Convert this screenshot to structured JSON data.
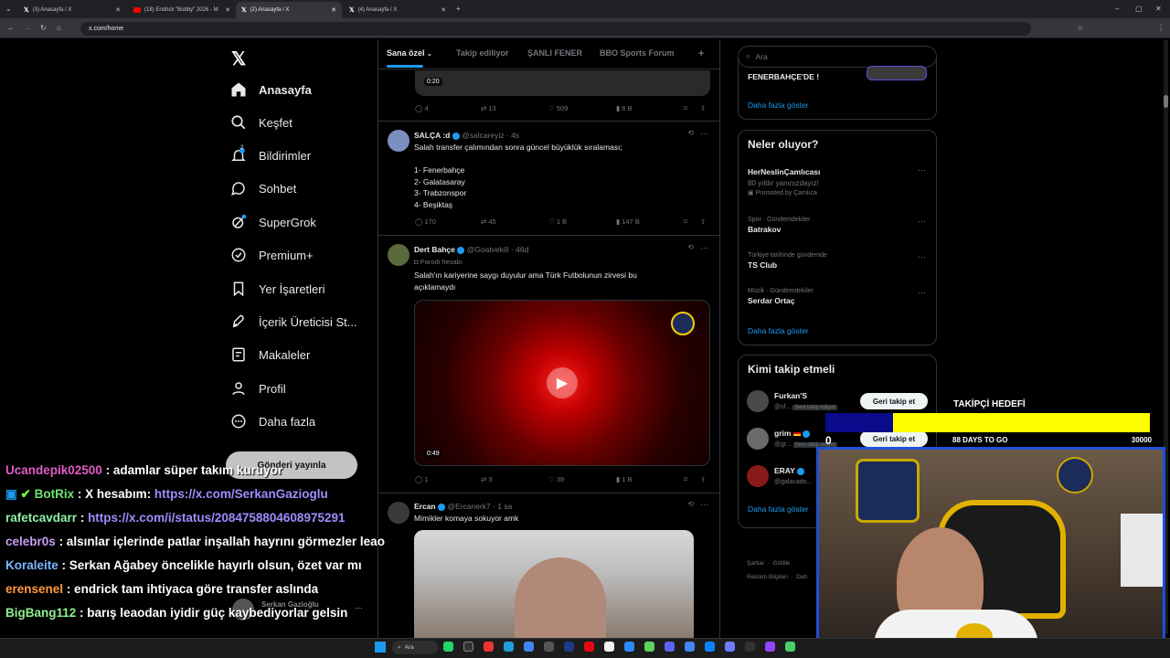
{
  "tabs": [
    {
      "title": "(3) Anasayfa / X"
    },
    {
      "title": "(18) Endrick \"Bobby\" 2026 - M"
    },
    {
      "title": "(2) Anasayfa / X"
    },
    {
      "title": "(4) Anasayfa / X"
    }
  ],
  "address": {
    "url": "x.com/home"
  },
  "nav": {
    "items": [
      "Anasayfa",
      "Keşfet",
      "Bildirimler",
      "Sohbet",
      "SuperGrok",
      "Premium+",
      "Yer İşaretleri",
      "İçerik Üreticisi St...",
      "Makaleler",
      "Profil",
      "Daha fazla"
    ],
    "notif_badge": "2",
    "post_button": "Gönderi yayınla",
    "account_name": "Serkan Gazioğlu"
  },
  "feed": {
    "tabs": [
      "Sana özel",
      "Takip ediliyor",
      "ŞANLI FENER",
      "BBO Sports Forum"
    ],
    "top_video_time": "0:20",
    "top_actions": {
      "replies": "4",
      "reposts": "13",
      "likes": "509",
      "views": "6 B"
    },
    "tweets": [
      {
        "name": "SALÇA :d",
        "handle": "@salcareyiz · 4s",
        "lines": [
          "Salah transfer çalımından sonra güncel büyüklük sıralaması;",
          "",
          "1- Fenerbahçe",
          "2- Galatasaray",
          "3- Trabzonspor",
          "4- Beşiktaş"
        ],
        "replies": "170",
        "reposts": "45",
        "likes": "1 B",
        "views": "147 B"
      },
      {
        "name": "Dert Bahçe",
        "handle": "@Goatvekili · 46d",
        "label": "Parodi hesabı",
        "lines": [
          "Salah'ın kariyerine saygı duyulur ama Türk Futbolunun zirvesi bu",
          "açıklamaydı"
        ],
        "video_time": "0:49",
        "replies": "1",
        "reposts": "3",
        "likes": "39",
        "views": "1 B"
      },
      {
        "name": "Ercan",
        "handle": "@Ercanerk7 · 1 sa",
        "lines": [
          "Mimikler komaya sokuyor amk"
        ]
      }
    ]
  },
  "right": {
    "search_placeholder": "Ara",
    "top_item": "FENERBAHÇE'DE !",
    "show_more": "Daha fazla göster",
    "trends_title": "Neler oluyor?",
    "trends": [
      {
        "context": "",
        "title": "HerNeslinÇamlıcası",
        "sub": "80 yıldır yanınızdayız!",
        "promo": "Promoted by Çamlıca"
      },
      {
        "context": "Spor · Gündemdekiler",
        "title": "Batrakov"
      },
      {
        "context": "Türkiye tarihinde gündemde",
        "title": "TS Club"
      },
      {
        "context": "Müzik · Gündemdekiler",
        "title": "Serdar Ortaç"
      }
    ],
    "who_title": "Kimi takip etmeli",
    "who": [
      {
        "name": "Furkan'S",
        "handle": "@sf...",
        "badge": "Seni takip ediyor",
        "button": "Geri takip et"
      },
      {
        "name": "grim",
        "handle": "@gr...",
        "badge": "Seni takip ediyor",
        "button": "Geri takip et"
      },
      {
        "name": "ERAY",
        "handle": "@galacado..."
      }
    ],
    "footer": [
      "Şartlar",
      "Gizlilik",
      "Reklam Bilgileri",
      "Dah"
    ]
  },
  "chat": [
    {
      "user": "Ucandepik02500",
      "msg": ": adamlar süper takım kuruyor",
      "color": "#e05cc8"
    },
    {
      "user": "BotRix",
      "msg": ": X hesabım: ",
      "link": "https://x.com/SerkanGazioglu",
      "color": "#6fe36f"
    },
    {
      "user": "rafetcavdarr",
      "msg": ": ",
      "link": "https://x.com/i/status/2084758804608975291",
      "color": "#8df0a8"
    },
    {
      "user": "celebr0s",
      "msg": ": alsınlar içlerinde patlar inşallah hayrını görmezler leao",
      "color": "#c79cf2"
    },
    {
      "user": "Koraleite",
      "msg": ": Serkan Ağabey öncelikle hayırlı olsun, özet var mı",
      "color": "#7ab6ff"
    },
    {
      "user": "erensenel",
      "msg": ": endrick tam ihtiyaca göre transfer aslında",
      "color": "#ff9a3c"
    },
    {
      "user": "BigBang112",
      "msg": ": barış leaodan iyidir güç kaybediyorlar gelsin",
      "color": "#8ff08f"
    }
  ],
  "goal": {
    "title": "TAKİPÇİ HEDEFİ",
    "current": "0",
    "days": "88 DAYS TO GO",
    "target": "30000",
    "progress": 0.0
  },
  "taskbar": {
    "search": "Ara"
  },
  "colors": {
    "accent": "#1d9bf0",
    "goal_fill": "#ffff00",
    "goal_bg": "#0a0a8a"
  }
}
